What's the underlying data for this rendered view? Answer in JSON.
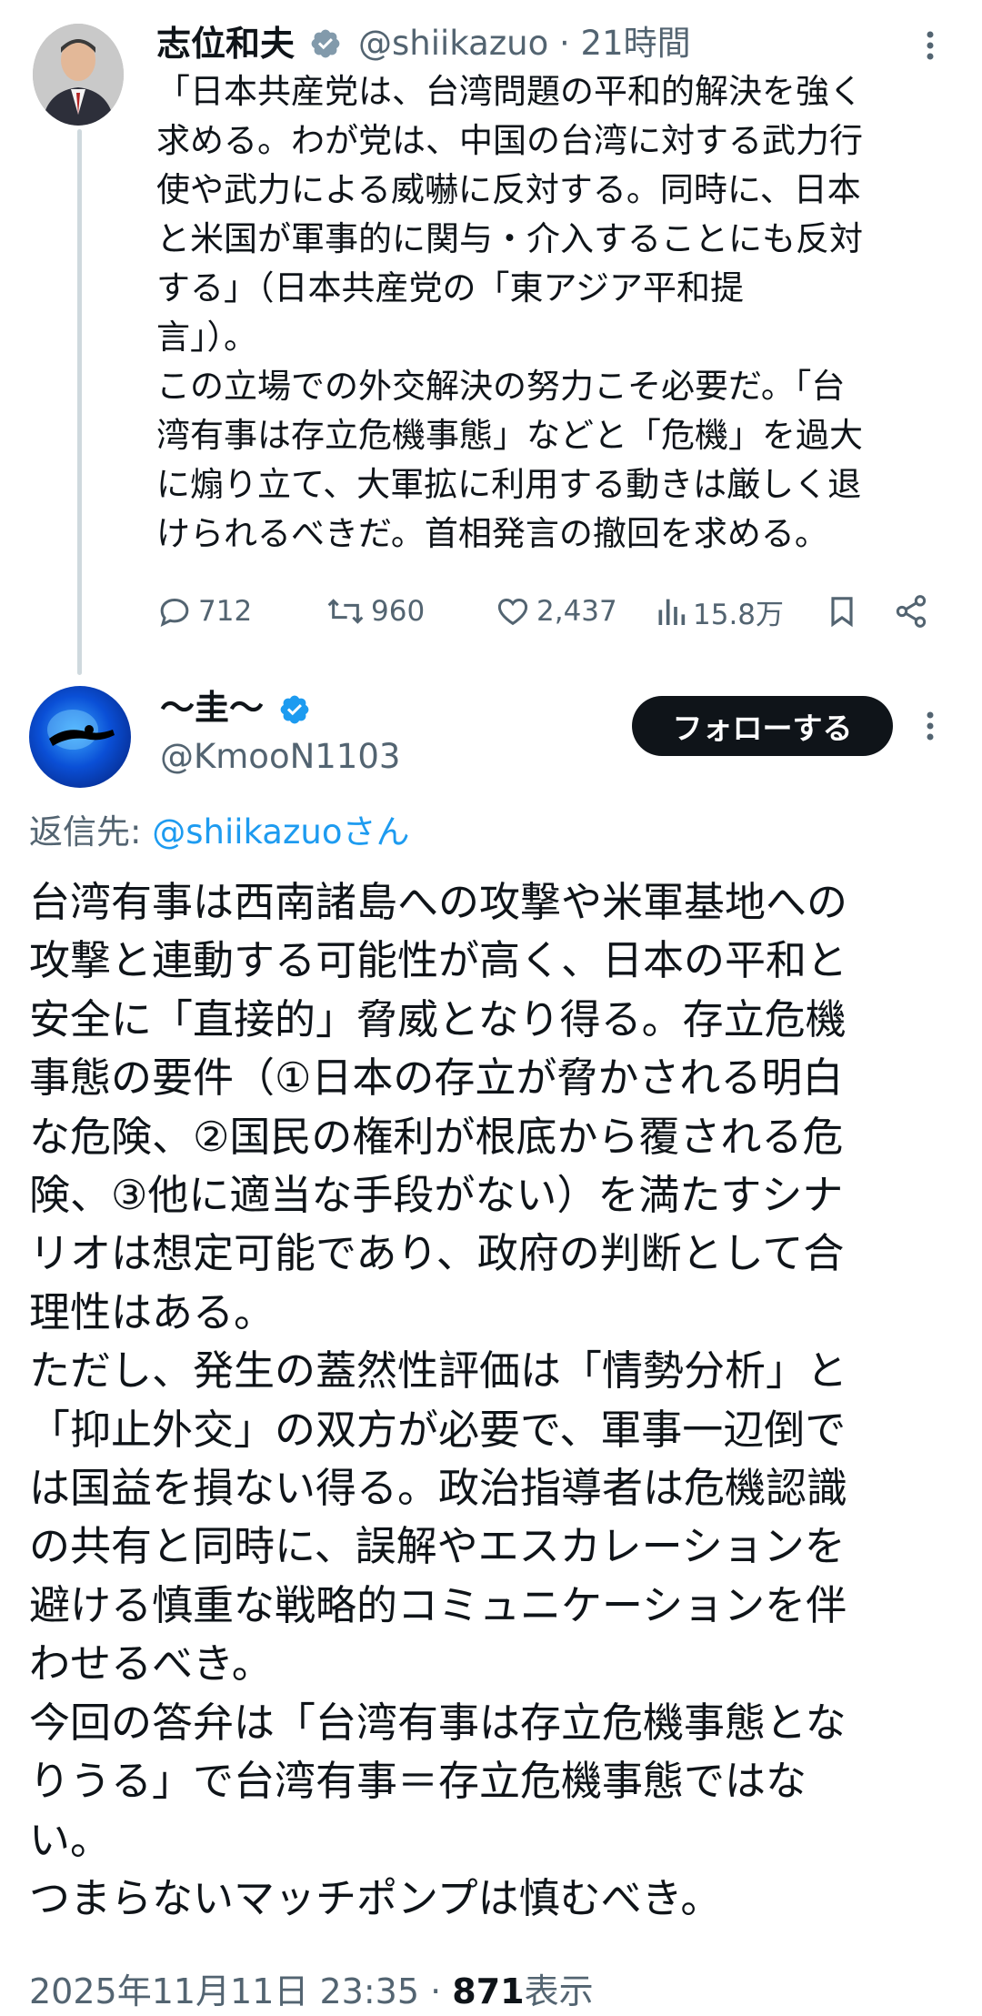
{
  "original_post": {
    "author_name": "志位和夫",
    "author_handle": "@shiikazuo",
    "separator": "·",
    "time": "21時間",
    "text": "「日本共産党は、台湾問題の平和的解決を強く\n求める。わが党は、中国の台湾に対する武力行\n使や武力による威嚇に反対する。同時に、日本\nと米国が軍事的に関与・介入することにも反対\nする」（日本共産党の「東アジア平和提\n言」）。\nこの立場での外交解決の努力こそ必要だ。「台\n湾有事は存立危機事態」などと「危機」を過大\nに煽り立て、大軍拡に利用する動きは厳しく退\nけられるべきだ。首相発言の撤回を求める。",
    "replies": "712",
    "reposts": "960",
    "likes": "2,437",
    "views": "15.8万"
  },
  "reply": {
    "author_name": "〜圭〜",
    "author_handle": "@KmooN1103",
    "follow_label": "フォローする",
    "reply_to_prefix": "返信先: ",
    "reply_to_handle": "@shiikazuoさん",
    "text": "台湾有事は西南諸島への攻撃や米軍基地への\n攻撃と連動する可能性が高く、日本の平和と\n安全に「直接的」脅威となり得る。存立危機\n事態の要件（①日本の存立が脅かされる明白\nな危険、②国民の権利が根底から覆される危\n険、③他に適当な手段がない）を満たすシナ\nリオは想定可能であり、政府の判断として合\n理性はある。\nただし、発生の蓋然性評価は「情勢分析」と\n「抑止外交」の双方が必要で、軍事一辺倒で\nは国益を損ない得る。政治指導者は危機認識\nの共有と同時に、誤解やエスカレーションを\n避ける慎重な戦略的コミュニケーションを伴\nわせるべき。\n今回の答弁は「台湾有事は存立危機事態とな\nりうる」で台湾有事＝存立危機事態ではな\nい。\nつまらないマッチポンプは慎むべき。",
    "timestamp": "2025年11月11日 23:35",
    "separator": "·",
    "view_count": "871",
    "view_label": "表示"
  },
  "colors": {
    "accent": "#1d9bf0",
    "secondary_text": "#536471",
    "verified": "#1d9bf0",
    "verified_gray": "#829aab"
  },
  "icons": [
    "verified-gray-icon",
    "more-icon",
    "reply-icon",
    "repost-icon",
    "like-icon",
    "views-icon",
    "bookmark-icon",
    "share-icon",
    "verified-blue-icon"
  ]
}
